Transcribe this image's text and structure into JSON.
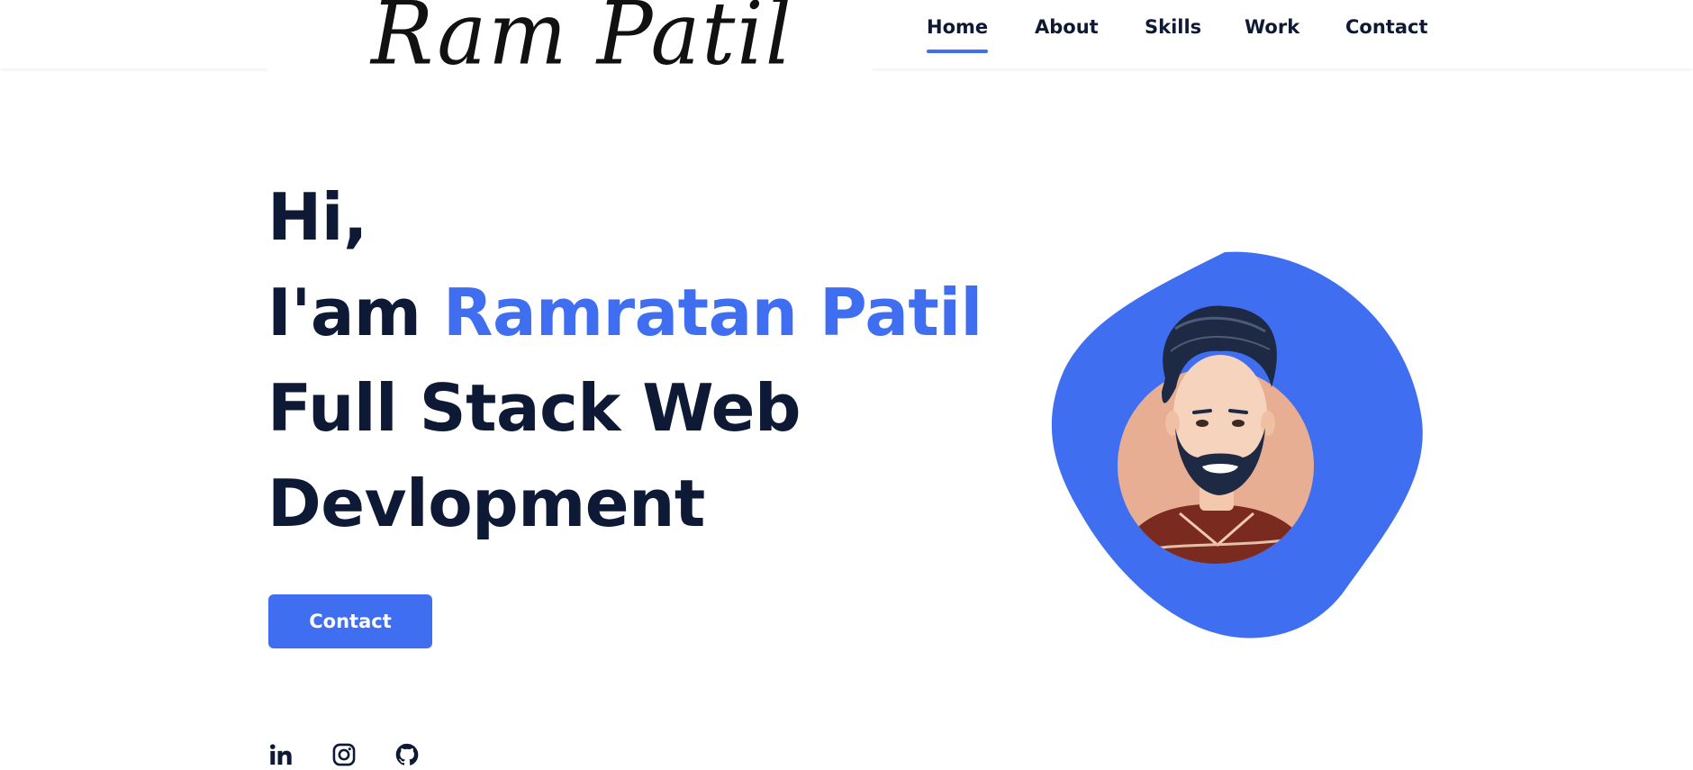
{
  "logo": {
    "text": "Ram Patil"
  },
  "nav": {
    "items": [
      {
        "label": "Home",
        "active": true
      },
      {
        "label": "About",
        "active": false
      },
      {
        "label": "Skills",
        "active": false
      },
      {
        "label": "Work",
        "active": false
      },
      {
        "label": "Contact",
        "active": false
      }
    ]
  },
  "hero": {
    "greeting": "Hi,",
    "intro_prefix": "I'am ",
    "name": "Ramratan Patil",
    "role_line1": "Full Stack Web",
    "role_line2": "Devlopment",
    "button_label": "Contact"
  },
  "socials": [
    {
      "icon": "linkedin-icon"
    },
    {
      "icon": "instagram-icon"
    },
    {
      "icon": "github-icon"
    }
  ],
  "colors": {
    "accent": "#3f6ff0",
    "text_dark": "#0e1a35",
    "avatar_bg": "#e7ae94"
  }
}
